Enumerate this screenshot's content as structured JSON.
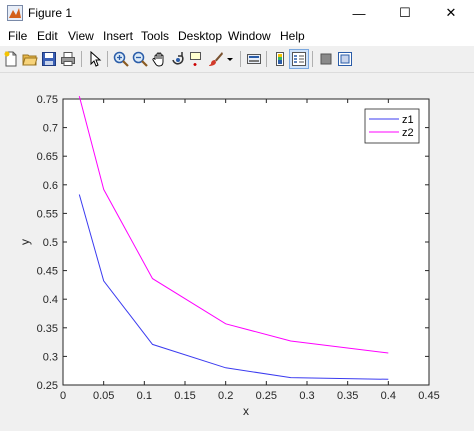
{
  "window": {
    "title": "Figure 1",
    "minimize_glyph": "—",
    "maximize_glyph": "☐",
    "close_glyph": "✕"
  },
  "menu": [
    "File",
    "Edit",
    "View",
    "Insert",
    "Tools",
    "Desktop",
    "Window",
    "Help"
  ],
  "toolbar": {
    "icons": [
      "new-figure-icon",
      "open-file-icon",
      "save-icon",
      "print-icon",
      "pointer-icon",
      "zoom-in-icon",
      "zoom-out-icon",
      "pan-icon",
      "rotate-3d-icon",
      "data-cursor-icon",
      "brush-icon",
      "brush-dropdown-icon",
      "link-plot-icon",
      "colorbar-icon",
      "legend-icon",
      "hide-plot-tools-icon",
      "show-plot-tools-icon"
    ]
  },
  "chart_data": {
    "type": "line",
    "xlabel": "x",
    "ylabel": "y",
    "xlim": [
      0,
      0.45
    ],
    "ylim": [
      0.25,
      0.75
    ],
    "xticks": [
      "0",
      "0.05",
      "0.1",
      "0.15",
      "0.2",
      "0.25",
      "0.3",
      "0.35",
      "0.4",
      "0.45"
    ],
    "yticks": [
      "0.25",
      "0.3",
      "0.35",
      "0.4",
      "0.45",
      "0.5",
      "0.55",
      "0.6",
      "0.65",
      "0.7",
      "0.75"
    ],
    "grid": false,
    "legend_position": "top-right",
    "series": [
      {
        "name": "z1",
        "color": "#3b3bf0",
        "x": [
          0.02,
          0.05,
          0.11,
          0.2,
          0.28,
          0.4
        ],
        "y": [
          0.583,
          0.432,
          0.321,
          0.28,
          0.263,
          0.26
        ]
      },
      {
        "name": "z2",
        "color": "#ff00ff",
        "x": [
          0.02,
          0.05,
          0.11,
          0.2,
          0.28,
          0.4
        ],
        "y": [
          0.755,
          0.592,
          0.436,
          0.357,
          0.327,
          0.306
        ]
      }
    ]
  }
}
